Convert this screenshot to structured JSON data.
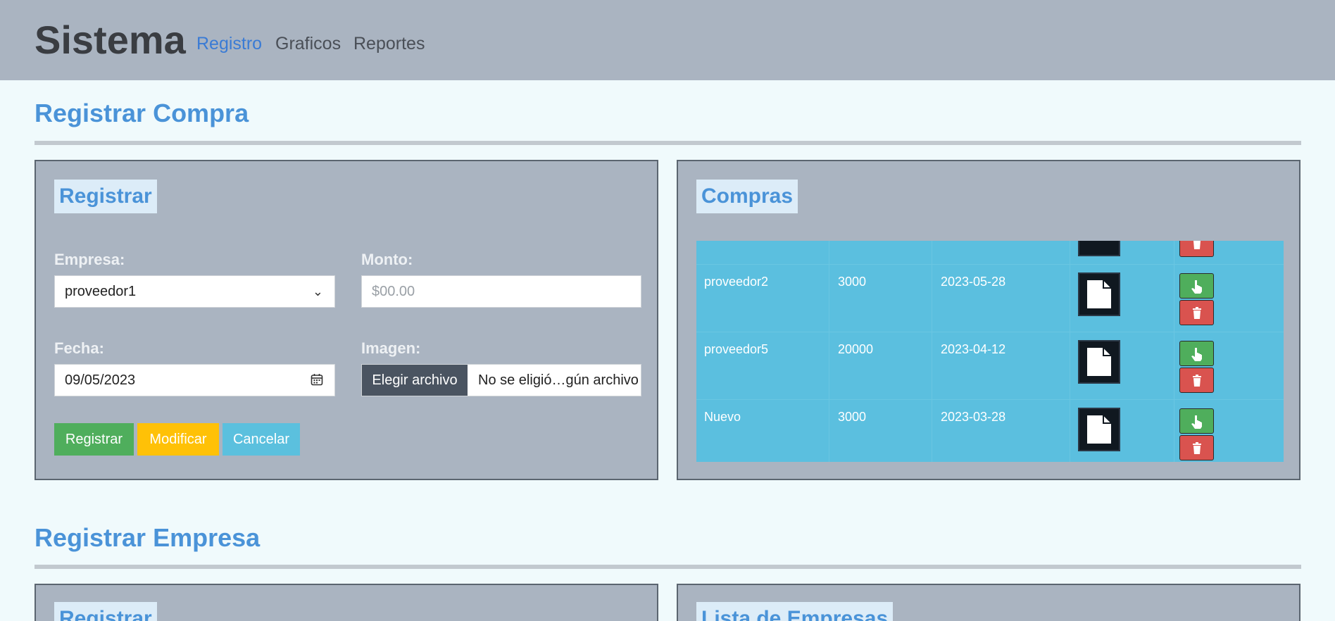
{
  "navbar": {
    "brand": "Sistema",
    "links": [
      {
        "label": "Registro",
        "active": true
      },
      {
        "label": "Graficos",
        "active": false
      },
      {
        "label": "Reportes",
        "active": false
      }
    ]
  },
  "compra_section": {
    "title": "Registrar Compra",
    "form": {
      "title": "Registrar",
      "empresa_label": "Empresa:",
      "empresa_value": "proveedor1",
      "monto_label": "Monto:",
      "monto_placeholder": "$00.00",
      "fecha_label": "Fecha:",
      "fecha_value": "09/05/2023",
      "imagen_label": "Imagen:",
      "file_button": "Elegir archivo",
      "file_status": "No se eligió…gún archivo",
      "buttons": {
        "registrar": "Registrar",
        "modificar": "Modificar",
        "cancelar": "Cancelar"
      }
    },
    "list": {
      "title": "Compras",
      "rows": [
        {
          "empresa": "proveedor2",
          "monto": "3000",
          "fecha": "2023-05-28"
        },
        {
          "empresa": "proveedor5",
          "monto": "20000",
          "fecha": "2023-04-12"
        },
        {
          "empresa": "Nuevo",
          "monto": "3000",
          "fecha": "2023-03-28"
        }
      ]
    }
  },
  "empresa_section": {
    "title": "Registrar Empresa",
    "form_title": "Registrar",
    "list_title": "Lista de Empresas"
  },
  "colors": {
    "accent": "#4a93d8",
    "success": "#4fae5c",
    "warning": "#ffc107",
    "info": "#5bc0de",
    "danger": "#d9534f"
  },
  "icons": [
    "calendar-icon",
    "chevron-down-icon",
    "document-icon",
    "hand-pointer-icon",
    "trash-icon"
  ]
}
